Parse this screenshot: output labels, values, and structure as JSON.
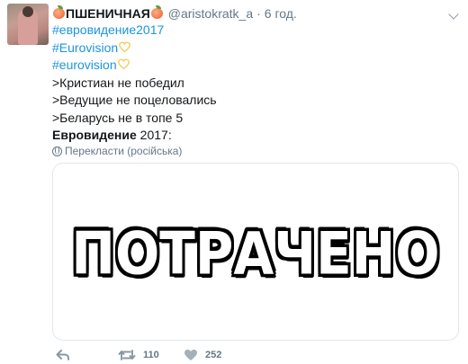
{
  "tweet": {
    "author_name": "ПШЕНИЧНАЯ",
    "author_emoji": "peach-emoji",
    "handle": "@aristokratk_a",
    "separator": "·",
    "time": "6 год.",
    "lines": [
      {
        "hashtag": "#евровидение2017"
      },
      {
        "hashtag": "#Eurovision",
        "emoji": "yellow-heart-emoji"
      },
      {
        "hashtag": "#eurovision",
        "emoji": "yellow-heart-emoji"
      },
      {
        "text": ">Кристиан не победил"
      },
      {
        "text": ">Ведущие не поцеловались"
      },
      {
        "text": ">Беларусь не в топе 5"
      }
    ],
    "last_line": {
      "bold": "Евровидение",
      "rest": " 2017:"
    },
    "translate_label": "Перекласти (російська)",
    "media": {
      "caption": "ПОТРАЧЕНО"
    },
    "actions": {
      "retweet_count": "110",
      "like_count": "252"
    }
  },
  "colors": {
    "link": "#1b95e0",
    "muted": "#657786",
    "text": "#14171a",
    "heart_emoji": "#f7c94b"
  }
}
